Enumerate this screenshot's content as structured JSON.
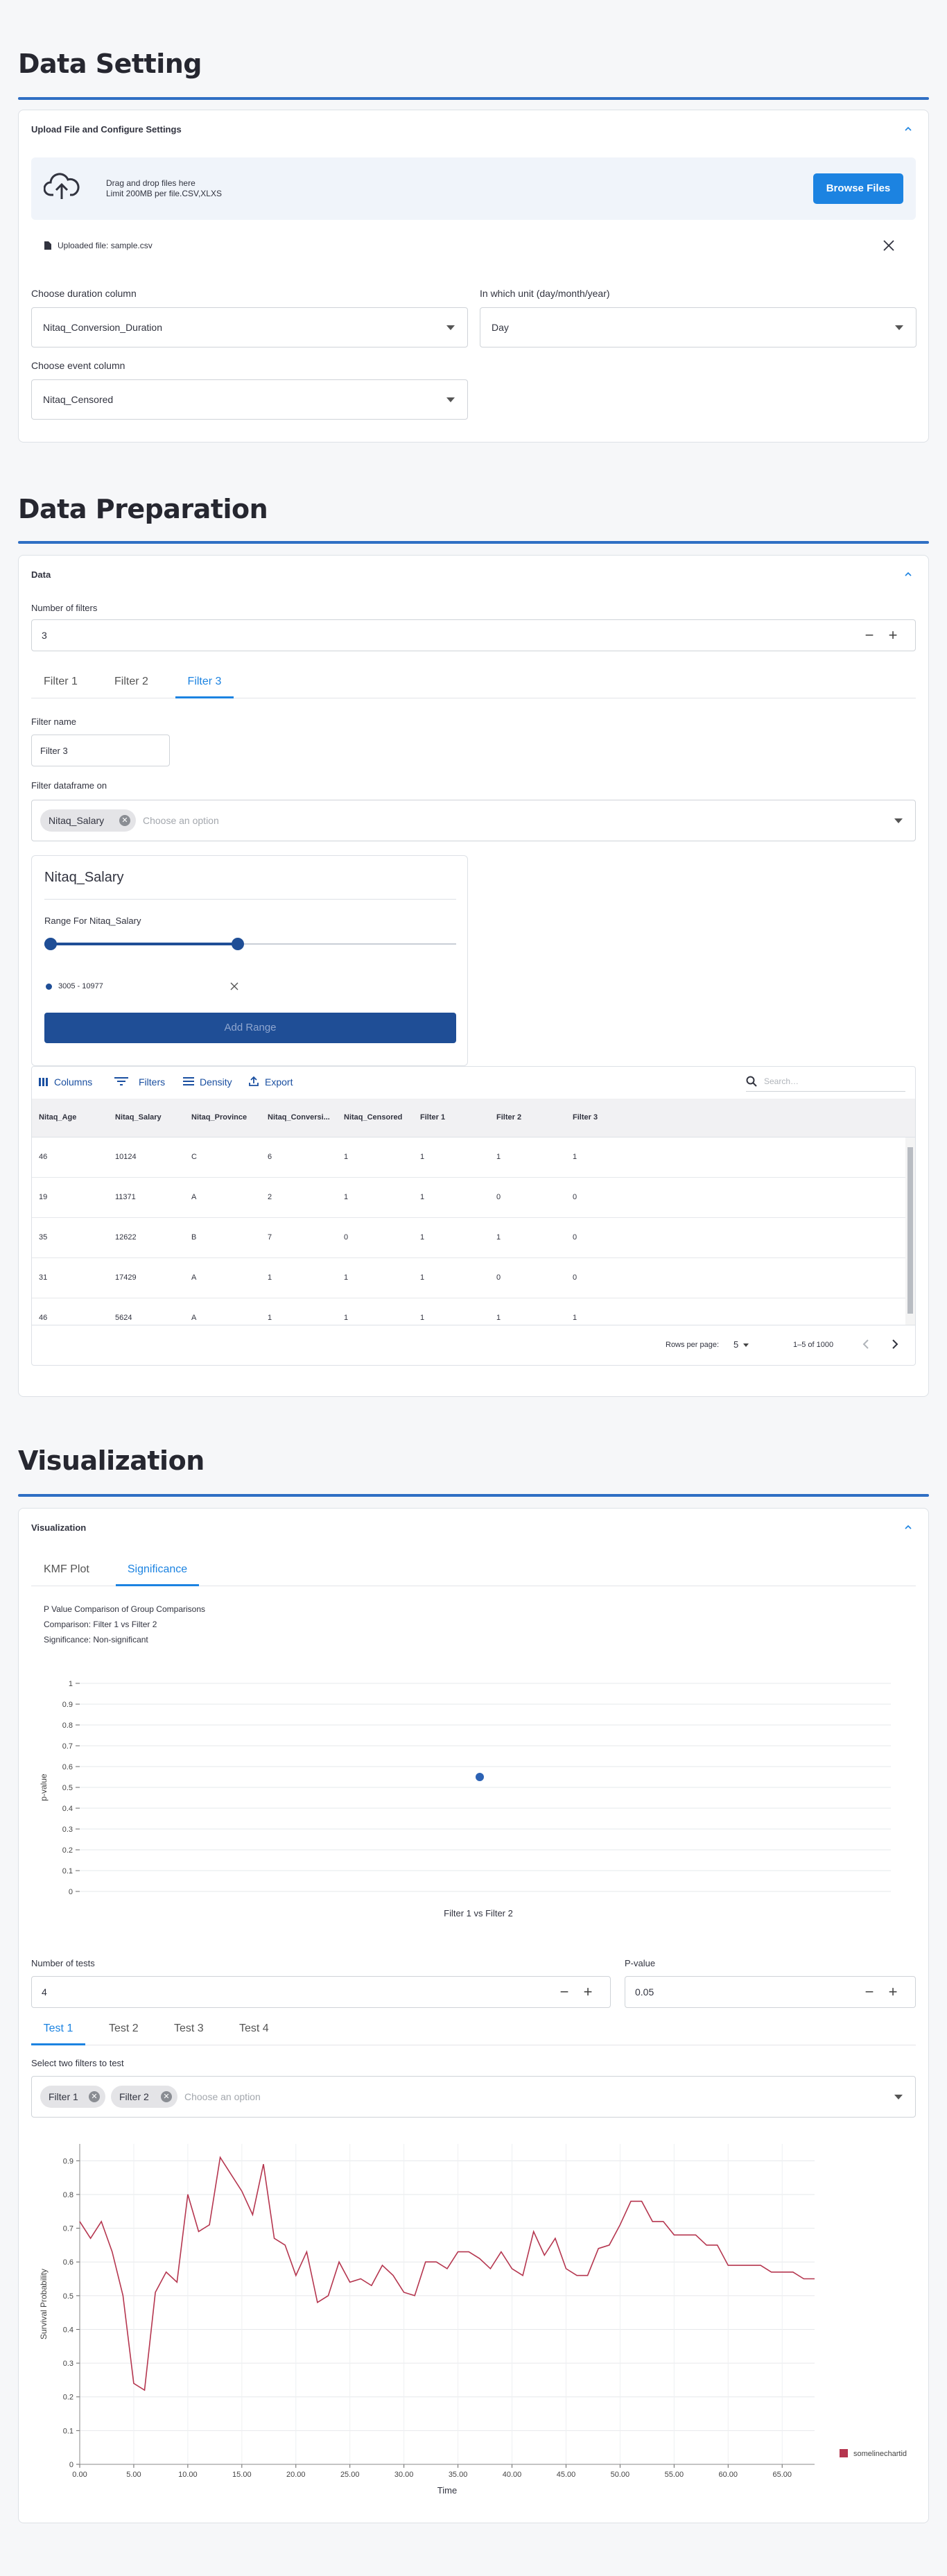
{
  "data_setting": {
    "title": "Data Setting",
    "card_title": "Upload File and Configure Settings",
    "dropzone_line1": "Drag and drop files here",
    "dropzone_line2": "Limit 200MB per file.CSV,XLXS",
    "browse_label": "Browse Files",
    "uploaded_file": "Uploaded file: sample.csv",
    "duration_label": "Choose duration column",
    "duration_value": "Nitaq_Conversion_Duration",
    "unit_label": "In which unit (day/month/year)",
    "unit_value": "Day",
    "event_label": "Choose event column",
    "event_value": "Nitaq_Censored"
  },
  "data_preparation": {
    "title": "Data Preparation",
    "card_title": "Data",
    "num_filters_label": "Number of filters",
    "num_filters_value": "3",
    "tabs": [
      "Filter 1",
      "Filter 2",
      "Filter 3"
    ],
    "filter_name_label": "Filter name",
    "filter_name_value": "Filter 3",
    "filter_on_label": "Filter dataframe on",
    "filter_on_chip": "Nitaq_Salary",
    "filter_on_placeholder": "Choose an option",
    "range_card_title": "Nitaq_Salary",
    "range_label": "Range For Nitaq_Salary",
    "range_item": "3005 - 10977",
    "range_slider_low": 0,
    "range_slider_high": 0.47,
    "add_range_label": "Add Range",
    "toolbar": {
      "columns": "Columns",
      "filters": "Filters",
      "density": "Density",
      "export": "Export",
      "search_placeholder": "Search…"
    },
    "table": {
      "headers": [
        "Nitaq_Age",
        "Nitaq_Salary",
        "Nitaq_Province",
        "Nitaq_Conversi...",
        "Nitaq_Censored",
        "Filter 1",
        "Filter 2",
        "Filter 3"
      ],
      "rows": [
        [
          "46",
          "10124",
          "C",
          "6",
          "1",
          "1",
          "1",
          "1"
        ],
        [
          "19",
          "11371",
          "A",
          "2",
          "1",
          "1",
          "0",
          "0"
        ],
        [
          "35",
          "12622",
          "B",
          "7",
          "0",
          "1",
          "1",
          "0"
        ],
        [
          "31",
          "17429",
          "A",
          "1",
          "1",
          "1",
          "0",
          "0"
        ],
        [
          "46",
          "5624",
          "A",
          "1",
          "1",
          "1",
          "1",
          "1"
        ]
      ]
    },
    "footer": {
      "rows_per_page_label": "Rows per page:",
      "rows_per_page_value": "5",
      "page_info": "1–5 of 1000"
    }
  },
  "visualization": {
    "title": "Visualization",
    "card_title": "Visualization",
    "tabs": [
      "KMF Plot",
      "Significance"
    ],
    "sig_title": "P Value Comparison of Group Comparisons",
    "sig_comparison": "Comparison: Filter 1 vs Filter 2",
    "sig_significance": "Significance: Non-significant",
    "num_tests_label": "Number of tests",
    "num_tests_value": "4",
    "pvalue_label": "P-value",
    "pvalue_value": "0.05",
    "test_tabs": [
      "Test 1",
      "Test 2",
      "Test 3",
      "Test 4"
    ],
    "select_filters_label": "Select two filters to test",
    "select_chips": [
      "Filter 1",
      "Filter 2"
    ],
    "select_placeholder": "Choose an option"
  },
  "colors": {
    "accent": "#1c83e1",
    "rule": "#2f6fc4",
    "button_dark": "#1f4e96",
    "line": "#b5364f",
    "dot": "#2c62b4"
  },
  "chart_data": [
    {
      "type": "scatter",
      "title": "",
      "xlabel": "Filter 1 vs Filter 2",
      "ylabel": "p-value",
      "ylim": [
        0,
        1
      ],
      "yticks": [
        0,
        0.1,
        0.2,
        0.3,
        0.4,
        0.5,
        0.6,
        0.7,
        0.8,
        0.9,
        1
      ],
      "points": [
        {
          "x": "Filter 1 vs Filter 2",
          "y": 0.55
        }
      ],
      "grid": true
    },
    {
      "type": "line",
      "xlabel": "Time",
      "ylabel": "Survival Probability",
      "ylim": [
        0,
        0.95
      ],
      "xlim": [
        0,
        68
      ],
      "xticks": [
        0,
        5,
        10,
        15,
        20,
        25,
        30,
        35,
        40,
        45,
        50,
        55,
        60,
        65
      ],
      "xtick_labels": [
        "0.00",
        "5.00",
        "10.00",
        "15.00",
        "20.00",
        "25.00",
        "30.00",
        "35.00",
        "40.00",
        "45.00",
        "50.00",
        "55.00",
        "60.00",
        "65.00"
      ],
      "yticks": [
        0,
        0.1,
        0.2,
        0.3,
        0.4,
        0.5,
        0.6,
        0.7,
        0.8,
        0.9
      ],
      "legend": "somelinechartid",
      "legend_position": "bottom-right",
      "grid": true,
      "x": [
        0,
        1,
        2,
        3,
        4,
        5,
        6,
        7,
        8,
        9,
        10,
        11,
        12,
        13,
        14,
        15,
        16,
        17,
        18,
        19,
        20,
        21,
        22,
        23,
        24,
        25,
        26,
        27,
        28,
        29,
        30,
        31,
        32,
        33,
        34,
        35,
        36,
        37,
        38,
        39,
        40,
        41,
        42,
        43,
        44,
        45,
        46,
        47,
        48,
        49,
        50,
        51,
        52,
        53,
        54,
        55,
        56,
        57,
        58,
        59,
        60,
        61,
        62,
        63,
        64,
        65,
        66,
        67,
        68
      ],
      "y": [
        0.72,
        0.67,
        0.72,
        0.63,
        0.5,
        0.24,
        0.22,
        0.51,
        0.57,
        0.54,
        0.8,
        0.69,
        0.71,
        0.91,
        0.86,
        0.81,
        0.74,
        0.89,
        0.67,
        0.65,
        0.56,
        0.63,
        0.48,
        0.5,
        0.6,
        0.54,
        0.55,
        0.53,
        0.59,
        0.56,
        0.51,
        0.5,
        0.6,
        0.6,
        0.58,
        0.63,
        0.63,
        0.61,
        0.58,
        0.63,
        0.58,
        0.56,
        0.69,
        0.62,
        0.67,
        0.58,
        0.56,
        0.56,
        0.64,
        0.65,
        0.71,
        0.78,
        0.78,
        0.72,
        0.72,
        0.68,
        0.68,
        0.68,
        0.65,
        0.65,
        0.59,
        0.59,
        0.59,
        0.59,
        0.57,
        0.57,
        0.57,
        0.55,
        0.55
      ]
    }
  ]
}
